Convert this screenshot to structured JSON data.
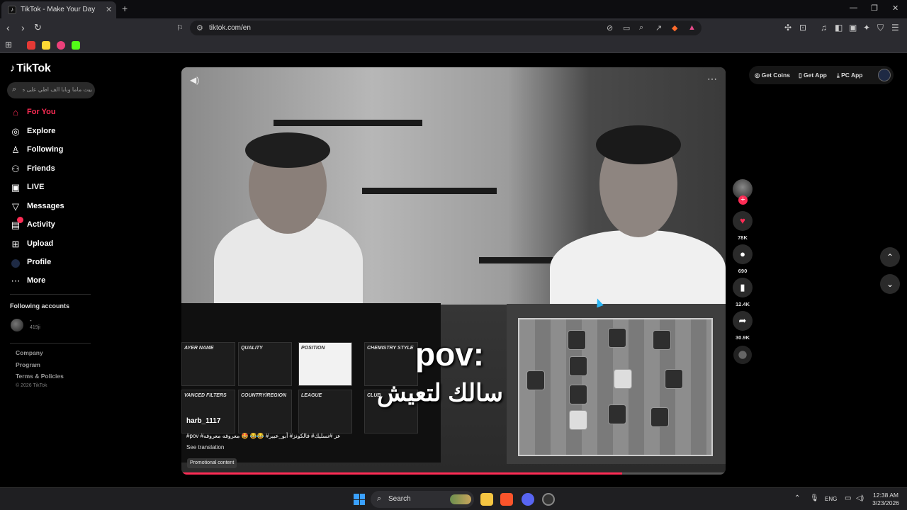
{
  "browser": {
    "tab_title": "TikTok - Make Your Day",
    "tab_close": "✕",
    "new_tab": "+",
    "url": "tiktok.com/en"
  },
  "window_controls": {
    "minimize": "—",
    "maximize": "❐",
    "close": "✕"
  },
  "sidebar": {
    "logo": "TikTok",
    "search_placeholder": "بيت ماما وبابا الف اطي على طول",
    "items": [
      {
        "label": "For You",
        "icon": "home-icon"
      },
      {
        "label": "Explore",
        "icon": "compass-icon"
      },
      {
        "label": "Following",
        "icon": "following-icon"
      },
      {
        "label": "Friends",
        "icon": "friends-icon"
      },
      {
        "label": "LIVE",
        "icon": "live-icon"
      },
      {
        "label": "Messages",
        "icon": "messages-icon"
      },
      {
        "label": "Activity",
        "icon": "activity-icon"
      },
      {
        "label": "Upload",
        "icon": "upload-icon"
      },
      {
        "label": "Profile",
        "icon": "profile-icon"
      },
      {
        "label": "More",
        "icon": "more-icon"
      }
    ],
    "following_title": "Following accounts",
    "following_account": {
      "name": "-",
      "sub": "419ji"
    },
    "footer": [
      "Company",
      "Program",
      "Terms & Policies"
    ],
    "copyright": "© 2026 TikTok"
  },
  "video": {
    "overlay_pov": "pov:",
    "overlay_arabic": "سالك لتعيش",
    "author": "harb_1117",
    "caption": "#pov #عز #تسليك# فالكونز# أبو_عبير# 😂😂 🤩 معروفه معروفه",
    "see_translation": "See translation",
    "promo": "Promotional content",
    "progress": 0.81,
    "search_cells": [
      "AYER NAME",
      "QUALITY",
      "POSITION",
      "CHEMISTRY STYLE",
      "VANCED FILTERS",
      "COUNTRY/REGION",
      "LEAGUE",
      "CLUB"
    ]
  },
  "actions": {
    "likes": "78K",
    "comments": "690",
    "saves": "12.4K",
    "shares": "30.9K"
  },
  "top_actions": {
    "coins": "Get Coins",
    "app": "Get App",
    "pc_app": "PC App"
  },
  "taskbar": {
    "search_label": "Search",
    "language": "ENG",
    "time": "12:38 AM",
    "date": "3/23/2026"
  },
  "colors": {
    "accent": "#fe2c55",
    "background": "#000000"
  }
}
